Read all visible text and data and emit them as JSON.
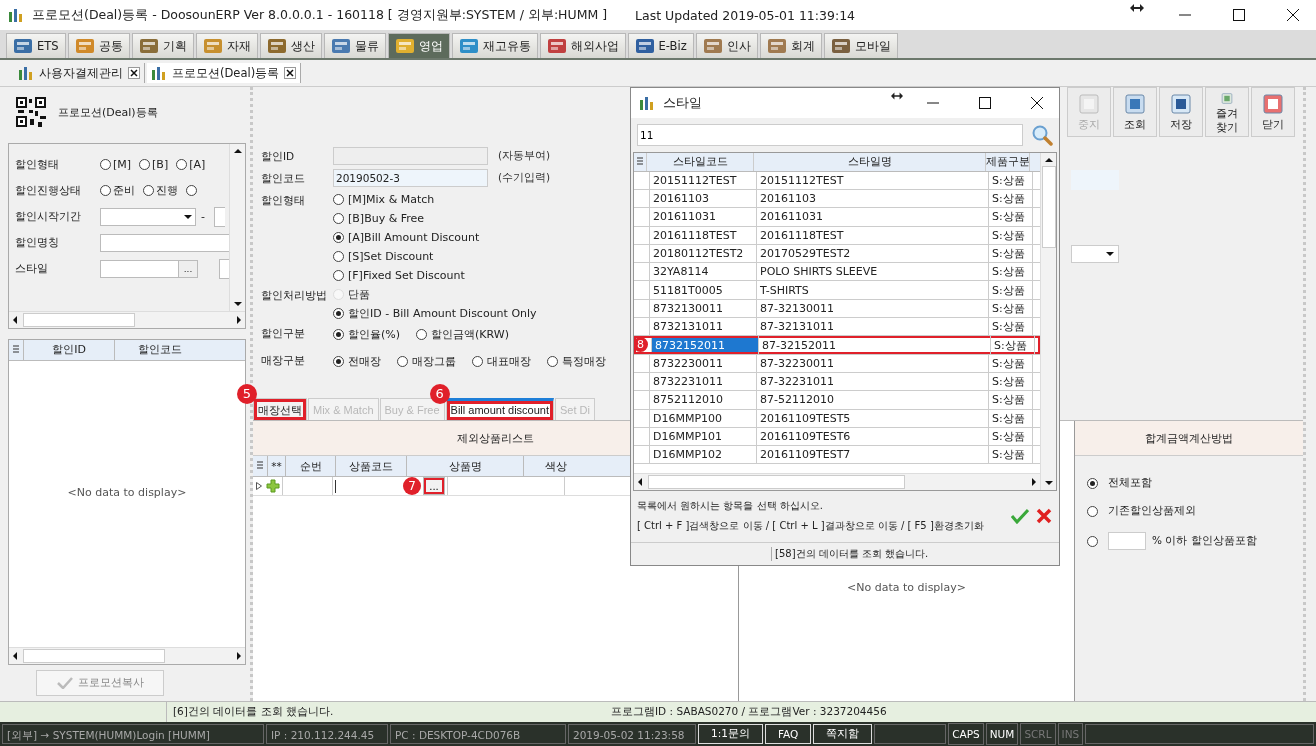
{
  "window": {
    "title": "프로모션(Deal)등록 - DoosounERP Ver 8.0.0.0.1 - 160118 [ 경영지원부:SYSTEM / 외부:HUMM ]",
    "last_updated": "Last Updated 2019-05-01 11:39:14"
  },
  "modules": [
    {
      "label": "ETS",
      "selected": false
    },
    {
      "label": "공통",
      "selected": false
    },
    {
      "label": "기획",
      "selected": false
    },
    {
      "label": "자재",
      "selected": false
    },
    {
      "label": "생산",
      "selected": false
    },
    {
      "label": "물류",
      "selected": false
    },
    {
      "label": "영업",
      "selected": true
    },
    {
      "label": "재고유통",
      "selected": false
    },
    {
      "label": "해외사업",
      "selected": false
    },
    {
      "label": "E-Biz",
      "selected": false
    },
    {
      "label": "인사",
      "selected": false
    },
    {
      "label": "회계",
      "selected": false
    },
    {
      "label": "모바일",
      "selected": false
    }
  ],
  "documents": [
    {
      "label": "사용자결제관리",
      "selected": false
    },
    {
      "label": "프로모션(Deal)등록",
      "selected": true
    }
  ],
  "page_header": {
    "title": "프로모션(Deal)등록"
  },
  "search": [
    {
      "label": "할인형태",
      "kind": "radios",
      "options": [
        {
          "label": "[M]",
          "selected": false
        },
        {
          "label": "[B]",
          "selected": false
        },
        {
          "label": "[A]",
          "selected": false
        }
      ]
    },
    {
      "label": "할인진행상태",
      "kind": "radios",
      "options": [
        {
          "label": "준비",
          "selected": false
        },
        {
          "label": "진행",
          "selected": false
        },
        {
          "selected": false
        }
      ]
    },
    {
      "label": "할인시작기간",
      "kind": "date_range",
      "separator": "-"
    },
    {
      "label": "할인명칭",
      "kind": "text"
    },
    {
      "label": "스타일",
      "kind": "lookup",
      "button": "..."
    }
  ],
  "left_grid": {
    "columns": [
      "할인ID",
      "할인코드"
    ],
    "empty": "<No data to display>"
  },
  "copy_button": {
    "label": "프로모션복사",
    "disabled": true
  },
  "toolbar": [
    {
      "label": "중지",
      "disabled": true
    },
    {
      "label": "조회",
      "disabled": false
    },
    {
      "label": "저장",
      "disabled": false
    },
    {
      "label": "즐겨찾기",
      "disabled": false
    },
    {
      "label": "닫기",
      "disabled": false
    }
  ],
  "form": [
    {
      "label": "할인ID",
      "kind": "input",
      "disabled": true,
      "note": "(자동부여)"
    },
    {
      "label": "할인코드",
      "kind": "input",
      "disabled": false,
      "value": "20190502-3",
      "note": "(수기입력)"
    },
    {
      "label": "할인형태",
      "kind": "radio_column",
      "options": [
        {
          "label": "[M]Mix & Match",
          "selected": false,
          "disabled": false
        },
        {
          "label": "[B]Buy & Free",
          "selected": false,
          "disabled": false
        },
        {
          "label": "[A]Bill Amount Discount",
          "selected": true,
          "disabled": false
        },
        {
          "label": "[S]Set Discount",
          "selected": false,
          "disabled": false
        },
        {
          "label": "[F]Fixed Set Discount",
          "selected": false,
          "disabled": false
        }
      ]
    },
    {
      "label": "할인처리방법",
      "kind": "radio_column",
      "options": [
        {
          "label": "단품",
          "selected": false,
          "disabled": true
        },
        {
          "label": "할인ID - Bill Amount Discount Only",
          "selected": true,
          "disabled": false
        }
      ]
    },
    {
      "label": "할인구분",
      "kind": "radio_row",
      "options": [
        {
          "label": "할인율(%)",
          "selected": true,
          "disabled": false
        },
        {
          "label": "할인금액(KRW)",
          "selected": false,
          "disabled": false
        }
      ]
    },
    {
      "label": "매장구분",
      "kind": "radio_row",
      "options": [
        {
          "label": "전매장",
          "selected": true,
          "disabled": false
        },
        {
          "label": "매장그룹",
          "selected": false,
          "disabled": false
        },
        {
          "label": "대표매장",
          "selected": false,
          "disabled": false
        },
        {
          "label": "특정매장",
          "selected": false,
          "disabled": false
        }
      ]
    }
  ],
  "detail_tabs": [
    {
      "label": "매장선택",
      "selected": false,
      "disabled": false,
      "callout": "5"
    },
    {
      "label": "Mix & Match",
      "selected": false,
      "disabled": true
    },
    {
      "label": "Buy & Free",
      "selected": false,
      "disabled": true
    },
    {
      "label": "Bill amount discount",
      "selected": true,
      "disabled": false,
      "callout": "6"
    },
    {
      "label": "Set Di",
      "selected": false,
      "disabled": true
    }
  ],
  "exclude_panel": {
    "title": "제외상품리스트",
    "columns": [
      "**",
      "순번",
      "상품코드",
      "상품명",
      "색상"
    ],
    "lookup_button": "...",
    "lookup_callout": "7"
  },
  "middle_panel": {
    "empty": "<No data to display>"
  },
  "sum_panel": {
    "title": "합계금액계산방법",
    "options": [
      {
        "label": "전체포함",
        "selected": true,
        "kind": "plain"
      },
      {
        "label": "기존할인상품제외",
        "selected": false,
        "kind": "plain"
      },
      {
        "label": "% 이하 할인상품포함",
        "selected": false,
        "kind": "percent"
      }
    ]
  },
  "status": {
    "message": "[6]건의 데이터를 조회 했습니다.",
    "program": "프로그램ID : SABAS0270 / 프로그램Ver : 3237204456"
  },
  "taskbar": {
    "cells": [
      "[외부] → SYSTEM(HUMM)Login [HUMM]",
      "IP : 210.112.244.45",
      "PC : DESKTOP-4CD076B",
      "2019-05-02 11:23:58"
    ],
    "buttons": [
      "1:1문의",
      "FAQ",
      "쪽지함"
    ],
    "indicators": [
      {
        "label": "CAPS",
        "on": true
      },
      {
        "label": "NUM",
        "on": true
      },
      {
        "label": "SCRL",
        "on": false
      },
      {
        "label": "INS",
        "on": false
      }
    ]
  },
  "popup": {
    "title": "스타일",
    "search": "11",
    "columns": [
      "스타일코드",
      "스타일명",
      "제품구분"
    ],
    "rows": [
      {
        "code": "20151112TEST",
        "name": "20151112TEST",
        "type": "S:상품",
        "selected": false
      },
      {
        "code": "20161103",
        "name": "20161103",
        "type": "S:상품",
        "selected": false
      },
      {
        "code": "201611031",
        "name": "201611031",
        "type": "S:상품",
        "selected": false
      },
      {
        "code": "20161118TEST",
        "name": "20161118TEST",
        "type": "S:상품",
        "selected": false
      },
      {
        "code": "20180112TEST2",
        "name": "20170529TEST2",
        "type": "S:상품",
        "selected": false
      },
      {
        "code": "32YA8114",
        "name": "POLO SHIRTS SLEEVE",
        "type": "S:상품",
        "selected": false
      },
      {
        "code": "51181T0005",
        "name": "T-SHIRTS",
        "type": "S:상품",
        "selected": false
      },
      {
        "code": "8732130011",
        "name": "87-32130011",
        "type": "S:상품",
        "selected": false
      },
      {
        "code": "8732131011",
        "name": "87-32131011",
        "type": "S:상품",
        "selected": false
      },
      {
        "code": "8732152011",
        "name": "87-32152011",
        "type": "S:상품",
        "selected": true,
        "callout": "8"
      },
      {
        "code": "8732230011",
        "name": "87-32230011",
        "type": "S:상품",
        "selected": false
      },
      {
        "code": "8732231011",
        "name": "87-32231011",
        "type": "S:상품",
        "selected": false
      },
      {
        "code": "8752112010",
        "name": "87-52112010",
        "type": "S:상품",
        "selected": false
      },
      {
        "code": "D16MMP100",
        "name": "20161109TEST5",
        "type": "S:상품",
        "selected": false
      },
      {
        "code": "D16MMP101",
        "name": "20161109TEST6",
        "type": "S:상품",
        "selected": false
      },
      {
        "code": "D16MMP102",
        "name": "20161109TEST7",
        "type": "S:상품",
        "selected": false
      }
    ],
    "hint": "목록에서 원하시는 항목을 선택 하십시오.",
    "shortcuts": "[ Ctrl + F ]검색창으로 이동 / [ Ctrl + L ]결과창으로 이동 / [ F5 ]환경초기화",
    "status": "[58]건의 데이터를 조회 했습니다."
  }
}
